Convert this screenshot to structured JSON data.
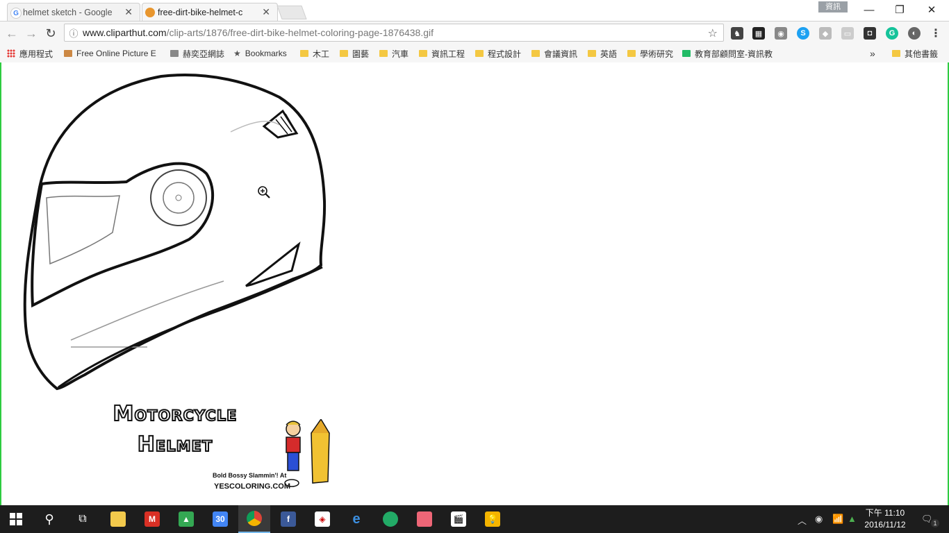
{
  "tabs": [
    {
      "title": "helmet sketch - Google",
      "favicon": "google-g-icon",
      "active": false
    },
    {
      "title": "free-dirt-bike-helmet-c",
      "favicon": "clipart-favicon-icon",
      "active": true
    }
  ],
  "window": {
    "ime_badge": "資訊"
  },
  "address_bar": {
    "host": "www.cliparthut.com",
    "path": "/clip-arts/1876/free-dirt-bike-helmet-coloring-page-1876438.gif"
  },
  "bookmarks": [
    {
      "label": "應用程式",
      "icon": "apps-icon"
    },
    {
      "label": "Free Online Picture E",
      "icon": "picture-icon"
    },
    {
      "label": "赫奕亞網誌",
      "icon": "blog-icon"
    },
    {
      "label": "Bookmarks",
      "icon": "star-icon"
    },
    {
      "label": "木工",
      "icon": "folder-icon"
    },
    {
      "label": "園藝",
      "icon": "folder-icon"
    },
    {
      "label": "汽車",
      "icon": "folder-icon"
    },
    {
      "label": "資訊工程",
      "icon": "folder-icon"
    },
    {
      "label": "程式設計",
      "icon": "folder-icon"
    },
    {
      "label": "會議資訊",
      "icon": "folder-icon"
    },
    {
      "label": "英語",
      "icon": "folder-icon"
    },
    {
      "label": "學術研究",
      "icon": "folder-icon"
    },
    {
      "label": "教育部顧問室-資訊教",
      "icon": "site-icon"
    }
  ],
  "bookmarks_overflow": "»",
  "bookmarks_other": "其他書籤",
  "image": {
    "title_line1": "Motorcycle",
    "title_line2": "Helmet",
    "credit": "Bold Bossy Slammin'! At",
    "site": "YESCOLORING.COM"
  },
  "taskbar": {
    "time": "下午 11:10",
    "date": "2016/11/12",
    "notification_count": "1",
    "calendar_day": "30"
  }
}
